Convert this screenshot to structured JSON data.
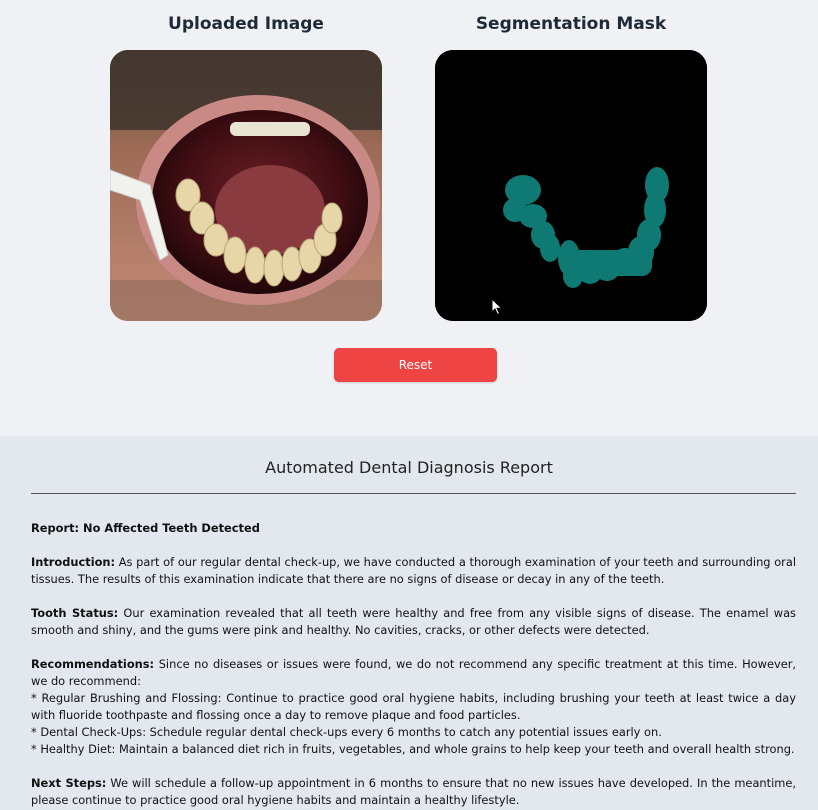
{
  "panels": {
    "uploaded_title": "Uploaded Image",
    "mask_title": "Segmentation Mask"
  },
  "actions": {
    "reset_label": "Reset"
  },
  "colors": {
    "reset_button": "#ef4444",
    "mask_fill": "#0f7a74",
    "mask_background": "#000000"
  },
  "report": {
    "title": "Automated Dental Diagnosis Report",
    "heading": "Report: No Affected Teeth Detected",
    "introduction_label": "Introduction:",
    "introduction_text": " As part of our regular dental check-up, we have conducted a thorough examination of your teeth and surrounding oral tissues. The results of this examination indicate that there are no signs of disease or decay in any of the teeth.",
    "tooth_status_label": "Tooth Status:",
    "tooth_status_text": " Our examination revealed that all teeth were healthy and free from any visible signs of disease. The enamel was smooth and shiny, and the gums were pink and healthy. No cavities, cracks, or other defects were detected.",
    "recommendations_label": "Recommendations:",
    "recommendations_text": " Since no diseases or issues were found, we do not recommend any specific treatment at this time. However, we do recommend:",
    "recommendation_items": [
      "* Regular Brushing and Flossing: Continue to practice good oral hygiene habits, including brushing your teeth at least twice a day with fluoride toothpaste and flossing once a day to remove plaque and food particles.",
      "* Dental Check-Ups: Schedule regular dental check-ups every 6 months to catch any potential issues early on.",
      "* Healthy Diet: Maintain a balanced diet rich in fruits, vegetables, and whole grains to help keep your teeth and overall health strong."
    ],
    "next_steps_label": "Next Steps:",
    "next_steps_text": " We will schedule a follow-up appointment in 6 months to ensure that no new issues have developed. In the meantime, please continue to practice good oral hygiene habits and maintain a healthy lifestyle."
  }
}
